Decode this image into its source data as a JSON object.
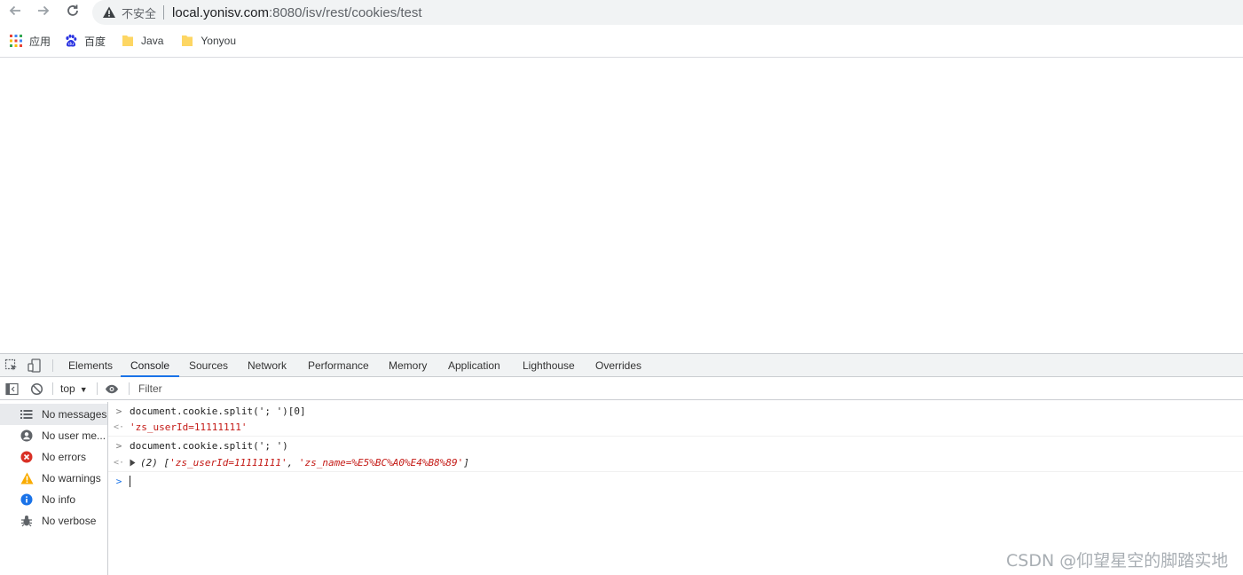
{
  "browser": {
    "security_label": "不安全",
    "url_host": "local.yonisv.com",
    "url_rest": ":8080/isv/rest/cookies/test",
    "icons": [
      "back-arrow-icon",
      "forward-arrow-icon",
      "reload-icon",
      "warning-triangle-icon"
    ]
  },
  "bookmarks": [
    {
      "label": "应用",
      "icon": "apps-grid-icon"
    },
    {
      "label": "百度",
      "icon": "baidu-paw-icon"
    },
    {
      "label": "Java",
      "icon": "folder-icon"
    },
    {
      "label": "Yonyou",
      "icon": "folder-icon"
    }
  ],
  "devtools": {
    "tabs": [
      "Elements",
      "Console",
      "Sources",
      "Network",
      "Performance",
      "Memory",
      "Application",
      "Lighthouse",
      "Overrides"
    ],
    "active_tab": "Console",
    "context": "top",
    "filter_placeholder": "Filter",
    "sidebar": [
      {
        "label": "No messages",
        "icon": "list-icon"
      },
      {
        "label": "No user me...",
        "icon": "user-circle-icon"
      },
      {
        "label": "No errors",
        "icon": "error-circle-icon"
      },
      {
        "label": "No warnings",
        "icon": "warning-triangle-icon"
      },
      {
        "label": "No info",
        "icon": "info-circle-icon"
      },
      {
        "label": "No verbose",
        "icon": "bug-icon"
      }
    ],
    "console_lines": [
      {
        "kind": "input",
        "text": "document.cookie.split('; ')[0]"
      },
      {
        "kind": "result",
        "text": "'zs_userId=11111111'"
      },
      {
        "kind": "input",
        "text": "document.cookie.split('; ')"
      },
      {
        "kind": "result",
        "count": "(2)",
        "open": "[",
        "item1": "'zs_userId=11111111'",
        "comma": ", ",
        "item2": "'zs_name=%E5%BC%A0%E4%B8%89'",
        "close": "]"
      }
    ]
  },
  "watermark": "CSDN @仰望星空的脚踏实地",
  "colors": {
    "accent": "#1a73e8",
    "string": "#c41a16",
    "error": "#d93025",
    "warning": "#f9ab00",
    "info": "#1a73e8"
  }
}
